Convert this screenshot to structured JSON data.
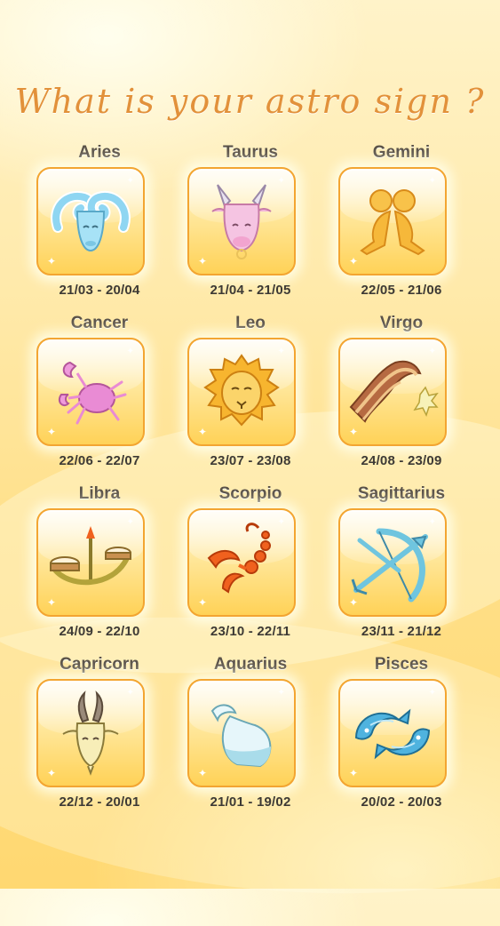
{
  "title": "What is your astro sign ?",
  "signs": [
    {
      "name": "Aries",
      "dates": "21/03 - 20/04",
      "icon": "ram-icon",
      "color": "#8fd6f2"
    },
    {
      "name": "Taurus",
      "dates": "21/04 - 21/05",
      "icon": "bull-icon",
      "color": "#f2b5d9"
    },
    {
      "name": "Gemini",
      "dates": "22/05 - 21/06",
      "icon": "twins-icon",
      "color": "#f6b83a"
    },
    {
      "name": "Cancer",
      "dates": "22/06 - 22/07",
      "icon": "crab-icon",
      "color": "#e98bd4"
    },
    {
      "name": "Leo",
      "dates": "23/07 - 23/08",
      "icon": "lion-icon",
      "color": "#f7b52f"
    },
    {
      "name": "Virgo",
      "dates": "24/08 - 23/09",
      "icon": "virgo-cloth-icon",
      "color": "#b66a42"
    },
    {
      "name": "Libra",
      "dates": "24/09 - 22/10",
      "icon": "scales-icon",
      "color": "#b3a33a"
    },
    {
      "name": "Scorpio",
      "dates": "23/10 - 22/11",
      "icon": "scorpion-icon",
      "color": "#f0611e"
    },
    {
      "name": "Sagittarius",
      "dates": "23/11 - 21/12",
      "icon": "bow-arrow-icon",
      "color": "#6fc5df"
    },
    {
      "name": "Capricorn",
      "dates": "22/12 - 20/01",
      "icon": "goat-icon",
      "color": "#f4e6a3"
    },
    {
      "name": "Aquarius",
      "dates": "21/01 - 19/02",
      "icon": "water-jar-icon",
      "color": "#cfeef3"
    },
    {
      "name": "Pisces",
      "dates": "20/02 - 20/03",
      "icon": "fish-icon",
      "color": "#4fb3df"
    }
  ]
}
